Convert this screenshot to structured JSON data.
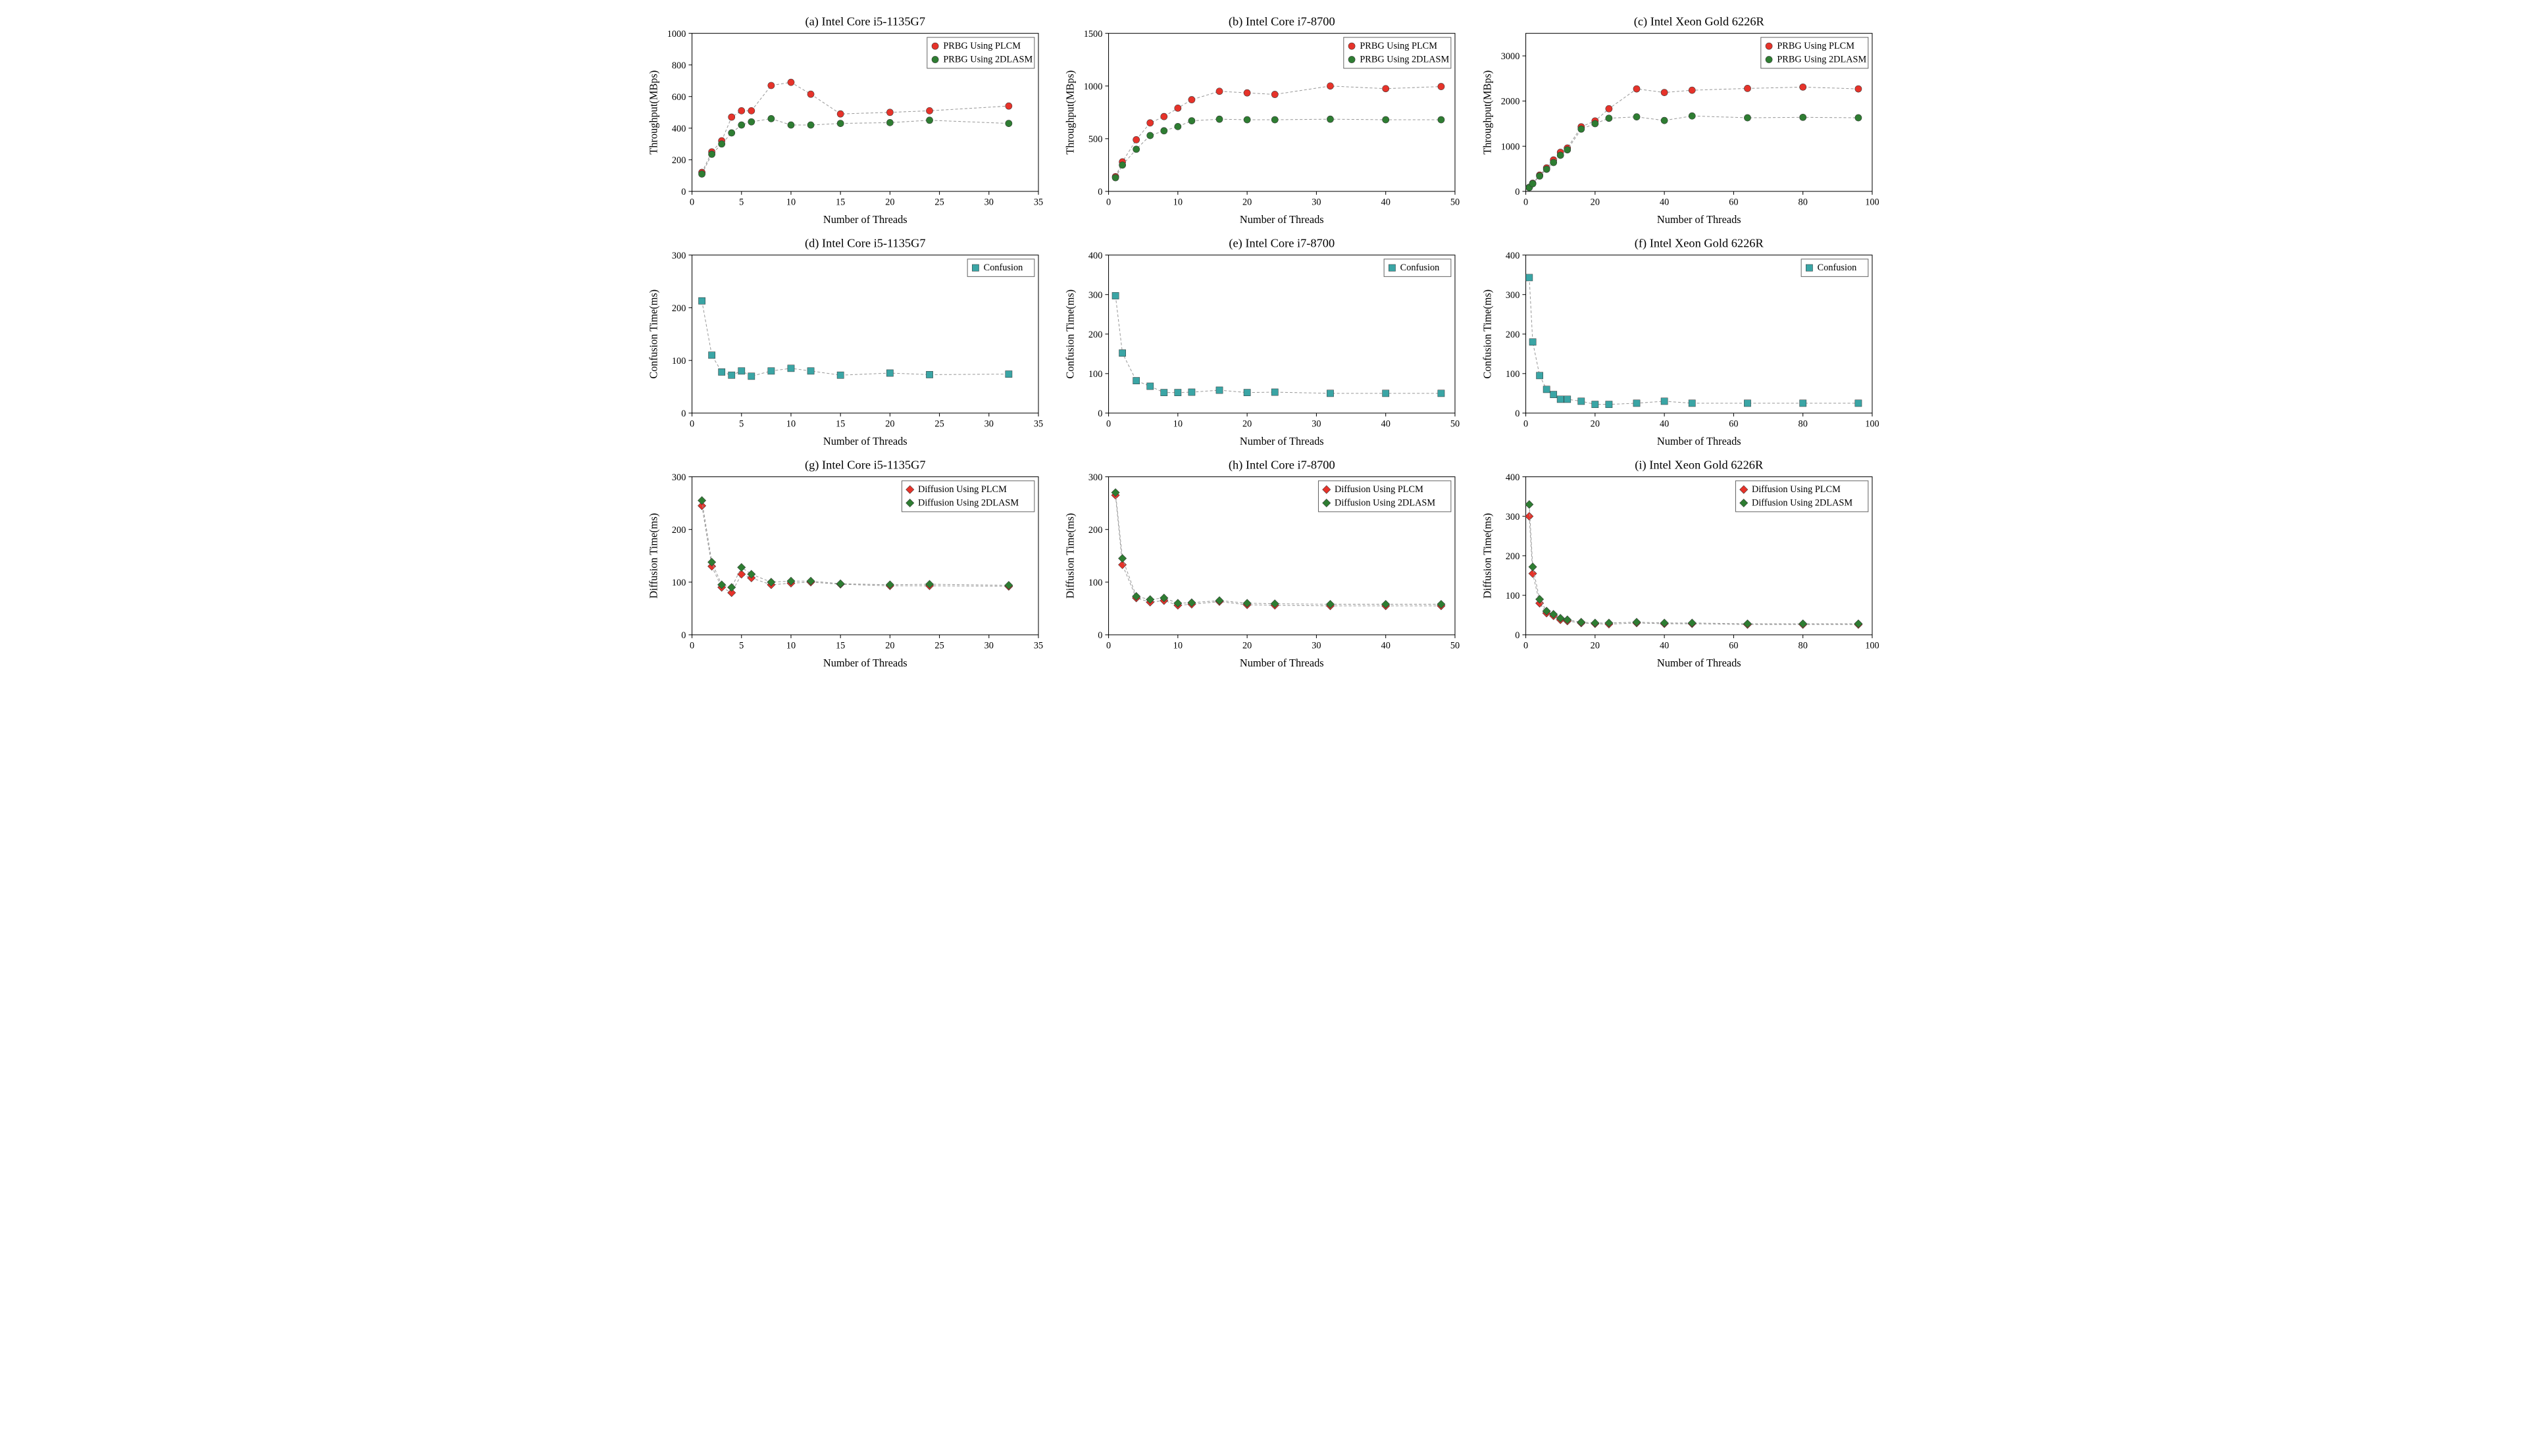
{
  "chart_data": [
    {
      "id": "a",
      "title": "(a) Intel Core i5-1135G7",
      "type": "line",
      "xlabel": "Number of Threads",
      "ylabel": "Throughput(MBps)",
      "xlim": [
        0,
        35
      ],
      "ylim": [
        0,
        1000
      ],
      "xticks": [
        0,
        5,
        10,
        15,
        20,
        25,
        30,
        35
      ],
      "yticks": [
        0,
        200,
        400,
        600,
        800,
        1000
      ],
      "series": [
        {
          "name": "PRBG Using PLCM",
          "color": "#e6332a",
          "marker": "circle",
          "x": [
            1,
            2,
            3,
            4,
            5,
            6,
            8,
            10,
            12,
            15,
            20,
            24,
            32
          ],
          "y": [
            120,
            250,
            320,
            470,
            510,
            510,
            670,
            690,
            615,
            490,
            500,
            510,
            540
          ]
        },
        {
          "name": "PRBG Using 2DLASM",
          "color": "#2e7d32",
          "marker": "circle",
          "x": [
            1,
            2,
            3,
            4,
            5,
            6,
            8,
            10,
            12,
            15,
            20,
            24,
            32
          ],
          "y": [
            110,
            235,
            300,
            370,
            420,
            440,
            460,
            420,
            420,
            430,
            435,
            450,
            430
          ]
        }
      ]
    },
    {
      "id": "b",
      "title": "(b) Intel Core i7-8700",
      "type": "line",
      "xlabel": "Number of Threads",
      "ylabel": "Throughput(MBps)",
      "xlim": [
        0,
        50
      ],
      "ylim": [
        0,
        1500
      ],
      "xticks": [
        0,
        10,
        20,
        30,
        40,
        50
      ],
      "yticks": [
        0,
        500,
        1000,
        1500
      ],
      "series": [
        {
          "name": "PRBG Using PLCM",
          "color": "#e6332a",
          "marker": "circle",
          "x": [
            1,
            2,
            4,
            6,
            8,
            10,
            12,
            16,
            20,
            24,
            32,
            40,
            48
          ],
          "y": [
            140,
            280,
            490,
            650,
            710,
            790,
            870,
            950,
            935,
            920,
            1000,
            975,
            995
          ]
        },
        {
          "name": "PRBG Using 2DLASM",
          "color": "#2e7d32",
          "marker": "circle",
          "x": [
            1,
            2,
            4,
            6,
            8,
            10,
            12,
            16,
            20,
            24,
            32,
            40,
            48
          ],
          "y": [
            130,
            250,
            400,
            530,
            575,
            615,
            670,
            685,
            680,
            680,
            685,
            680,
            680
          ]
        }
      ]
    },
    {
      "id": "c",
      "title": "(c) Intel Xeon Gold 6226R",
      "type": "line",
      "xlabel": "Number of Threads",
      "ylabel": "Throughput(MBps)",
      "xlim": [
        0,
        100
      ],
      "ylim": [
        0,
        3500
      ],
      "xticks": [
        0,
        20,
        40,
        60,
        80,
        100
      ],
      "yticks": [
        0,
        1000,
        2000,
        3000
      ],
      "series": [
        {
          "name": "PRBG Using PLCM",
          "color": "#e6332a",
          "marker": "circle",
          "x": [
            1,
            2,
            4,
            6,
            8,
            10,
            12,
            16,
            20,
            24,
            32,
            40,
            48,
            64,
            80,
            96
          ],
          "y": [
            90,
            180,
            360,
            520,
            695,
            865,
            960,
            1430,
            1560,
            1830,
            2270,
            2190,
            2240,
            2280,
            2310,
            2270
          ]
        },
        {
          "name": "PRBG Using 2DLASM",
          "color": "#2e7d32",
          "marker": "circle",
          "x": [
            1,
            2,
            4,
            6,
            8,
            10,
            12,
            16,
            20,
            24,
            32,
            40,
            48,
            64,
            80,
            96
          ],
          "y": [
            85,
            170,
            340,
            490,
            640,
            800,
            920,
            1380,
            1500,
            1620,
            1650,
            1570,
            1670,
            1630,
            1640,
            1630
          ]
        }
      ]
    },
    {
      "id": "d",
      "title": "(d) Intel Core i5-1135G7",
      "type": "line",
      "xlabel": "Number of Threads",
      "ylabel": "Confusion Time(ms)",
      "xlim": [
        0,
        35
      ],
      "ylim": [
        0,
        300
      ],
      "xticks": [
        0,
        5,
        10,
        15,
        20,
        25,
        30,
        35
      ],
      "yticks": [
        0,
        100,
        200,
        300
      ],
      "series": [
        {
          "name": "Confusion",
          "color": "#3aa5a5",
          "marker": "square",
          "x": [
            1,
            2,
            3,
            4,
            5,
            6,
            8,
            10,
            12,
            15,
            20,
            24,
            32
          ],
          "y": [
            213,
            110,
            78,
            72,
            80,
            70,
            80,
            85,
            80,
            72,
            76,
            73,
            74
          ]
        }
      ]
    },
    {
      "id": "e",
      "title": "(e) Intel Core i7-8700",
      "type": "line",
      "xlabel": "Number of Threads",
      "ylabel": "Confusion Time(ms)",
      "xlim": [
        0,
        50
      ],
      "ylim": [
        0,
        400
      ],
      "xticks": [
        0,
        10,
        20,
        30,
        40,
        50
      ],
      "yticks": [
        0,
        100,
        200,
        300,
        400
      ],
      "series": [
        {
          "name": "Confusion",
          "color": "#3aa5a5",
          "marker": "square",
          "x": [
            1,
            2,
            4,
            6,
            8,
            10,
            12,
            16,
            20,
            24,
            32,
            40,
            48
          ],
          "y": [
            297,
            152,
            82,
            68,
            52,
            52,
            53,
            58,
            52,
            53,
            50,
            50,
            50
          ]
        }
      ]
    },
    {
      "id": "f",
      "title": "(f) Intel Xeon Gold 6226R",
      "type": "line",
      "xlabel": "Number of Threads",
      "ylabel": "Confusion Time(ms)",
      "xlim": [
        0,
        100
      ],
      "ylim": [
        0,
        400
      ],
      "xticks": [
        0,
        20,
        40,
        60,
        80,
        100
      ],
      "yticks": [
        0,
        100,
        200,
        300,
        400
      ],
      "series": [
        {
          "name": "Confusion",
          "color": "#3aa5a5",
          "marker": "square",
          "x": [
            1,
            2,
            4,
            6,
            8,
            10,
            12,
            16,
            20,
            24,
            32,
            40,
            48,
            64,
            80,
            96
          ],
          "y": [
            343,
            180,
            95,
            60,
            47,
            35,
            35,
            30,
            22,
            22,
            25,
            30,
            25,
            25,
            25,
            25
          ]
        }
      ]
    },
    {
      "id": "g",
      "title": "(g) Intel Core i5-1135G7",
      "type": "line",
      "xlabel": "Number of Threads",
      "ylabel": "Diffusion Time(ms)",
      "xlim": [
        0,
        35
      ],
      "ylim": [
        0,
        300
      ],
      "xticks": [
        0,
        5,
        10,
        15,
        20,
        25,
        30,
        35
      ],
      "yticks": [
        0,
        100,
        200,
        300
      ],
      "series": [
        {
          "name": "Diffusion Using PLCM",
          "color": "#e6332a",
          "marker": "diamond",
          "x": [
            1,
            2,
            3,
            4,
            5,
            6,
            8,
            10,
            12,
            15,
            20,
            24,
            32
          ],
          "y": [
            245,
            130,
            90,
            80,
            115,
            108,
            95,
            98,
            100,
            96,
            93,
            93,
            92
          ]
        },
        {
          "name": "Diffusion Using 2DLASM",
          "color": "#2e7d32",
          "marker": "diamond",
          "x": [
            1,
            2,
            3,
            4,
            5,
            6,
            8,
            10,
            12,
            15,
            20,
            24,
            32
          ],
          "y": [
            255,
            138,
            95,
            90,
            128,
            115,
            100,
            102,
            102,
            97,
            95,
            96,
            94
          ]
        }
      ]
    },
    {
      "id": "h",
      "title": "(h) Intel Core i7-8700",
      "type": "line",
      "xlabel": "Number of Threads",
      "ylabel": "Diffusion Time(ms)",
      "xlim": [
        0,
        50
      ],
      "ylim": [
        0,
        300
      ],
      "xticks": [
        0,
        10,
        20,
        30,
        40,
        50
      ],
      "yticks": [
        0,
        100,
        200,
        300
      ],
      "series": [
        {
          "name": "Diffusion Using PLCM",
          "color": "#e6332a",
          "marker": "diamond",
          "x": [
            1,
            2,
            4,
            6,
            8,
            10,
            12,
            16,
            20,
            24,
            32,
            40,
            48
          ],
          "y": [
            265,
            133,
            70,
            62,
            65,
            56,
            58,
            63,
            57,
            56,
            55,
            55,
            55
          ]
        },
        {
          "name": "Diffusion Using 2DLASM",
          "color": "#2e7d32",
          "marker": "diamond",
          "x": [
            1,
            2,
            4,
            6,
            8,
            10,
            12,
            16,
            20,
            24,
            32,
            40,
            48
          ],
          "y": [
            270,
            145,
            73,
            67,
            70,
            60,
            61,
            65,
            60,
            59,
            58,
            58,
            58
          ]
        }
      ]
    },
    {
      "id": "i",
      "title": "(i) Intel Xeon Gold 6226R",
      "type": "line",
      "xlabel": "Number of Threads",
      "ylabel": "Diffusion Time(ms)",
      "xlim": [
        0,
        100
      ],
      "ylim": [
        0,
        400
      ],
      "xticks": [
        0,
        20,
        40,
        60,
        80,
        100
      ],
      "yticks": [
        0,
        100,
        200,
        300,
        400
      ],
      "series": [
        {
          "name": "Diffusion Using PLCM",
          "color": "#e6332a",
          "marker": "diamond",
          "x": [
            1,
            2,
            4,
            6,
            8,
            10,
            12,
            16,
            20,
            24,
            32,
            40,
            48,
            64,
            80,
            96
          ],
          "y": [
            300,
            155,
            80,
            55,
            48,
            38,
            35,
            30,
            28,
            27,
            30,
            28,
            28,
            26,
            26,
            26
          ]
        },
        {
          "name": "Diffusion Using 2DLASM",
          "color": "#2e7d32",
          "marker": "diamond",
          "x": [
            1,
            2,
            4,
            6,
            8,
            10,
            12,
            16,
            20,
            24,
            32,
            40,
            48,
            64,
            80,
            96
          ],
          "y": [
            330,
            172,
            90,
            60,
            52,
            42,
            38,
            32,
            30,
            30,
            32,
            30,
            30,
            28,
            28,
            28
          ]
        }
      ]
    }
  ]
}
